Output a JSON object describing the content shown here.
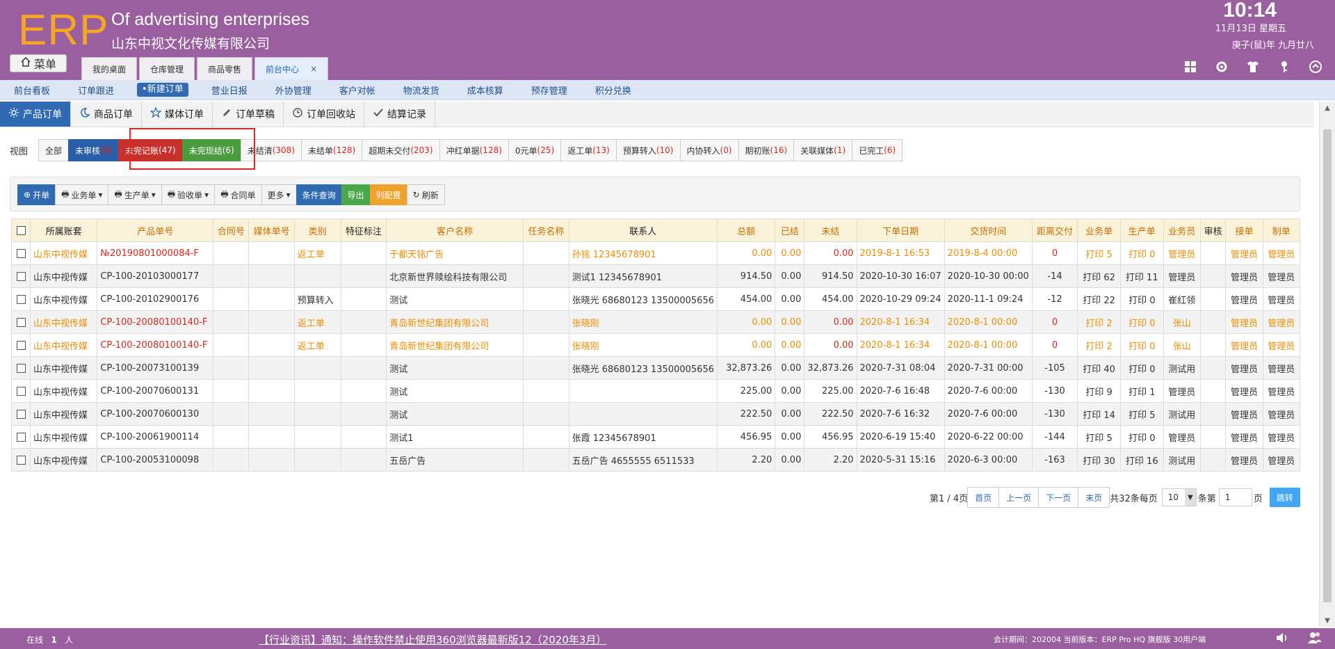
{
  "header": {
    "logo": "ERP",
    "company_en": "Of advertising enterprises",
    "company_cn": "山东中视文化传媒有限公司",
    "time": "10:14",
    "date": "11月13日 星期五",
    "lunar": "庚子(鼠)年 九月廿八",
    "menu_label": "菜单",
    "tabs": [
      {
        "label": "我的桌面"
      },
      {
        "label": "仓库管理"
      },
      {
        "label": "商品零售"
      },
      {
        "label": "前台中心"
      }
    ],
    "tab_close": "×"
  },
  "nav": {
    "items": [
      "前台看板",
      "订单跟进",
      "•新建订单",
      "营业日报",
      "外协管理",
      "客户对帐",
      "物流发货",
      "成本核算",
      "预存管理",
      "积分兑换"
    ]
  },
  "subtabs": [
    "产品订单",
    "商品订单",
    "媒体订单",
    "订单草稿",
    "订单回收站",
    "结算记录"
  ],
  "views": {
    "label": "视图",
    "buttons": [
      {
        "text": "全部",
        "count": ""
      },
      {
        "text": "未审核",
        "count": "(8)"
      },
      {
        "text": "未完记账",
        "count": "(47)"
      },
      {
        "text": "未完现结",
        "count": "(6)"
      },
      {
        "text": "未结清",
        "count": "(308)"
      },
      {
        "text": "未结单",
        "count": "(128)"
      },
      {
        "text": "超期未交付",
        "count": "(203)"
      },
      {
        "text": "冲红单据",
        "count": "(128)"
      },
      {
        "text": "0元单",
        "count": "(25)"
      },
      {
        "text": "返工单",
        "count": "(13)"
      },
      {
        "text": "预算转入",
        "count": "(10)"
      },
      {
        "text": "内协转入",
        "count": "(0)"
      },
      {
        "text": "期初账",
        "count": "(16)"
      },
      {
        "text": "关联媒体",
        "count": "(1)"
      },
      {
        "text": "已完工",
        "count": "(6)"
      }
    ]
  },
  "toolbar": {
    "new": "开单",
    "business": "业务单",
    "production": "生产单",
    "acceptance": "验收单",
    "contract": "合同单",
    "more": "更多",
    "query": "条件查询",
    "export": "导出",
    "columns": "列配置",
    "refresh": "刷新"
  },
  "table": {
    "headers": [
      "所属账套",
      "产品单号",
      "合同号",
      "媒体单号",
      "类别",
      "特征标注",
      "客户名称",
      "任务名称",
      "联系人",
      "总额",
      "已结",
      "未结",
      "下单日期",
      "交货时间",
      "距离交付",
      "业务单",
      "生产单",
      "业务员",
      "审核",
      "接单",
      "制单"
    ],
    "rows": [
      {
        "style": "orange",
        "cells": [
          "山东中视传媒",
          "№20190801000084-F",
          "",
          "",
          "返工单",
          "",
          "于都天铭广告",
          "",
          "孙铭 12345678901",
          "0.00",
          "0.00",
          "0.00",
          "2019-8-1 16:53",
          "2019-8-4 00:00",
          "0",
          "打印 5",
          "打印 0",
          "管理员",
          "",
          "管理员",
          "管理员"
        ]
      },
      {
        "style": "normal",
        "cells": [
          "山东中视传媒",
          "CP-100-20103000177",
          "",
          "",
          "",
          "",
          "北京新世界赎绘科技有限公司",
          "",
          "测试1 12345678901",
          "914.50",
          "0.00",
          "914.50",
          "2020-10-30 16:07",
          "2020-10-30 00:00",
          "-14",
          "打印 62",
          "打印 11",
          "管理员",
          "",
          "管理员",
          "管理员"
        ]
      },
      {
        "style": "normal",
        "cells": [
          "山东中视传媒",
          "CP-100-20102900176",
          "",
          "",
          "预算转入",
          "",
          "测试",
          "",
          "张晓光 68680123 13500005656",
          "454.00",
          "0.00",
          "454.00",
          "2020-10-29 09:24",
          "2020-11-1 09:24",
          "-12",
          "打印 22",
          "打印 0",
          "崔红领",
          "",
          "管理员",
          "管理员"
        ]
      },
      {
        "style": "orange",
        "cells": [
          "山东中视传媒",
          "CP-100-20080100140-F",
          "",
          "",
          "返工单",
          "",
          "青岛新世纪集团有限公司",
          "",
          "张晓刚",
          "0.00",
          "0.00",
          "0.00",
          "2020-8-1 16:34",
          "2020-8-1 00:00",
          "0",
          "打印 2",
          "打印 0",
          "张山",
          "",
          "管理员",
          "管理员"
        ]
      },
      {
        "style": "orange",
        "cells": [
          "山东中视传媒",
          "CP-100-20080100140-F",
          "",
          "",
          "返工单",
          "",
          "青岛新世纪集团有限公司",
          "",
          "张晓刚",
          "0.00",
          "0.00",
          "0.00",
          "2020-8-1 16:34",
          "2020-8-1 00:00",
          "0",
          "打印 2",
          "打印 0",
          "张山",
          "",
          "管理员",
          "管理员"
        ]
      },
      {
        "style": "normal",
        "cells": [
          "山东中视传媒",
          "CP-100-20073100139",
          "",
          "",
          "",
          "",
          "测试",
          "",
          "张晓光 68680123 13500005656",
          "32,873.26",
          "0.00",
          "32,873.26",
          "2020-7-31 08:04",
          "2020-7-31 00:00",
          "-105",
          "打印 40",
          "打印 0",
          "测试用",
          "",
          "管理员",
          "管理员"
        ]
      },
      {
        "style": "normal",
        "cells": [
          "山东中视传媒",
          "CP-100-20070600131",
          "",
          "",
          "",
          "",
          "测试",
          "",
          "",
          "225.00",
          "0.00",
          "225.00",
          "2020-7-6 16:48",
          "2020-7-6 00:00",
          "-130",
          "打印 9",
          "打印 1",
          "管理员",
          "",
          "管理员",
          "管理员"
        ]
      },
      {
        "style": "normal",
        "cells": [
          "山东中视传媒",
          "CP-100-20070600130",
          "",
          "",
          "",
          "",
          "测试",
          "",
          "",
          "222.50",
          "0.00",
          "222.50",
          "2020-7-6 16:32",
          "2020-7-6 00:00",
          "-130",
          "打印 14",
          "打印 5",
          "测试用",
          "",
          "管理员",
          "管理员"
        ]
      },
      {
        "style": "normal",
        "cells": [
          "山东中视传媒",
          "CP-100-20061900114",
          "",
          "",
          "",
          "",
          "测试1",
          "",
          "张霞 12345678901",
          "456.95",
          "0.00",
          "456.95",
          "2020-6-19 15:40",
          "2020-6-22 00:00",
          "-144",
          "打印 5",
          "打印 0",
          "管理员",
          "",
          "管理员",
          "管理员"
        ]
      },
      {
        "style": "normal",
        "cells": [
          "山东中视传媒",
          "CP-100-20053100098",
          "",
          "",
          "",
          "",
          "五岳广告",
          "",
          "五岳广告 4655555 6511533",
          "2.20",
          "0.00",
          "2.20",
          "2020-5-31 15:16",
          "2020-6-3 00:00",
          "-163",
          "打印 30",
          "打印 16",
          "测试用",
          "",
          "管理员",
          "管理员"
        ]
      }
    ]
  },
  "pager": {
    "page_info": "第1 / 4页",
    "first": "首页",
    "prev": "上一页",
    "next": "下一页",
    "last": "末页",
    "total_prefix": "共32条每页",
    "page_size": "10",
    "unit_text": "条第",
    "page_input": "1",
    "page_suffix": "页",
    "go": "跳转"
  },
  "footer": {
    "online_label": "在线",
    "online_count": "1",
    "online_unit": "人",
    "news": "【行业资讯】通知：操作软件禁止使用360浏览器最新版12（2020年3月）",
    "meta": "会计期间：202004 当前版本：ERP Pro HQ 旗舰版 30用户端"
  },
  "colors": {
    "header": "#9a5f9e",
    "accent": "#2f6ab3",
    "highlight": "#e12424",
    "red_text": "#d9261c",
    "orange_text": "#f08c00"
  }
}
